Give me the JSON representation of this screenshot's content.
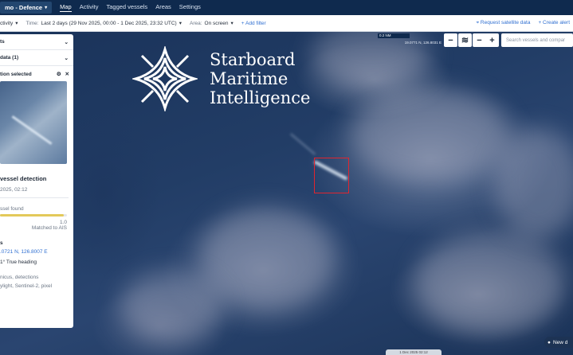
{
  "topbar": {
    "project": "mo - Defence",
    "nav": [
      "Map",
      "Activity",
      "Tagged vessels",
      "Areas",
      "Settings"
    ]
  },
  "filterbar": {
    "activity": "ctivity",
    "time_label": "Time:",
    "time_value": "Last 2 days (29 Nov 2025, 00:00 - 1 Dec 2025, 23:32 UTC)",
    "area_label": "Area:",
    "area_value": "On screen",
    "add_filter": "+ Add filter",
    "request_satellite": "Request satellite data",
    "create_alert": "+ Create alert"
  },
  "map": {
    "scale": "0.2 NM",
    "coords": "19.0771 N, 126.8031 E",
    "search_placeholder": "Search vessels and compar",
    "zoom_out": "−",
    "zoom_in": "+",
    "minus_btn": "−",
    "layers_btn": "≋",
    "bottom_tab": "1 Dec 2025 02:12",
    "new_detection": "New d",
    "colors": {
      "detection_box": "#e0252f",
      "accent": "#2f6fd1"
    }
  },
  "logo": {
    "line1": "Starboard",
    "line2": "Maritime",
    "line3": "Intelligence"
  },
  "panel": {
    "row1": "ts",
    "row2": "data (1)",
    "selected": "tion selected",
    "title": "vessel detection",
    "date": "2025, 02:12",
    "vessel_found": "ssel found",
    "scale_max": "1.0",
    "vessel_found_fraction": 0.95,
    "matched": "Matched to AIS",
    "coords_head": "s",
    "coords": ".0721 N, 126.8007 E",
    "heading": "1° True heading",
    "source1": "nicus, detections",
    "source2": "ylight, Sentinel-2, pixel"
  }
}
